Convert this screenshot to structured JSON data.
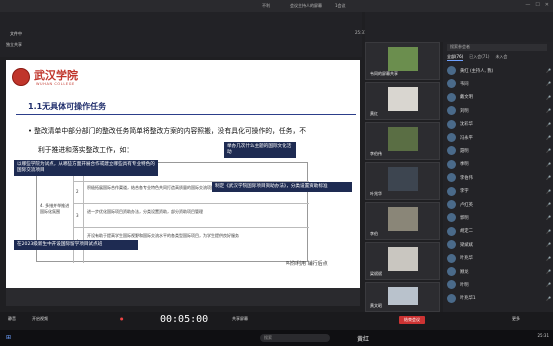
{
  "window": {
    "title_prefix": "不利",
    "title": "会议主持人的屏幕",
    "title_suffix": "1会议",
    "time_display": "25:31"
  },
  "toolbar": {
    "file_label": "文件中",
    "back_label": "独立共享"
  },
  "slide": {
    "school_name": "武汉学院",
    "school_en": "WUHAN COLLEGE",
    "section_title": "1.1无具体可操作任务",
    "bullet_1": "• 整改清单中部分部门的整改任务简单将整改方案的内容照搬，没有具化可操作的，任务，不",
    "bullet_2": "利于推进和落实整改工作，如：",
    "table": {
      "row_label": "4. 多措并举推进国际化氛围",
      "rows": [
        {
          "num": "1",
          "text": "积极拓展国际合作渠道，加强国际化"
        },
        {
          "num": "2",
          "text": "积极拓展国际合作渠道，结合各专业特色共同打造高质量的国际交流项目"
        },
        {
          "num": "3",
          "text": "进一步优化国际项目资助办法，分类设置资助，部分资助项目管理"
        },
        {
          "num": "4",
          "text": "开设有助于提高学生国际视野和国际交流水平的各类型国际项目，为学生提供良好服务"
        }
      ]
    },
    "notes": [
      "以哪些学院为试点，从哪些方面开展合作或建立哪些具有专业特色的国际交流项目",
      "举办几次什么主题的国际文化活动",
      "制定《武汉学院国际项目资助办法》，分类设置资助标准",
      "在2023级新生中开设国际留学项目试点班"
    ],
    "signature": "叫你利用 辅行后点"
  },
  "gallery": {
    "tiles": [
      {
        "label": "韦同的屏幕共享"
      },
      {
        "label": "黄红"
      },
      {
        "label": "李伯伟"
      },
      {
        "label": "叶兆华"
      },
      {
        "label": "李伯"
      },
      {
        "label": "梁斌斌"
      },
      {
        "label": "黄文昭"
      }
    ]
  },
  "participants": {
    "search_placeholder": "搜索参会者",
    "tabs": [
      "全部(76)",
      "已入会(71)",
      "未入会"
    ],
    "people": [
      {
        "name": "黄红 (主持人, 我)",
        "status": "mic"
      },
      {
        "name": "韦同",
        "status": "mic"
      },
      {
        "name": "戴文明",
        "status": "mic"
      },
      {
        "name": "刘明",
        "status": "mic"
      },
      {
        "name": "沈彩华",
        "status": "mic"
      },
      {
        "name": "冯永平",
        "status": "mic"
      },
      {
        "name": "聂明",
        "status": "mic"
      },
      {
        "name": "季明",
        "status": "mic"
      },
      {
        "name": "李伯伟",
        "status": "mic"
      },
      {
        "name": "李宇",
        "status": "mic"
      },
      {
        "name": "卢红英",
        "status": "mic"
      },
      {
        "name": "郭明",
        "status": "mic"
      },
      {
        "name": "胡定二",
        "status": "mic"
      },
      {
        "name": "梁斌斌",
        "status": "mic"
      },
      {
        "name": "叶兆华",
        "status": "mic"
      },
      {
        "name": "顾龙",
        "status": "mic"
      },
      {
        "name": "叶明",
        "status": "mic"
      },
      {
        "name": "叶兆华1",
        "status": "mic"
      }
    ]
  },
  "controls": {
    "timer": "00:05:00",
    "mute_label": "静音",
    "video_label": "开启视频",
    "end_label": "结束会议",
    "share_label": "共享屏幕",
    "more_label": "更多"
  },
  "taskbar": {
    "search_placeholder": "搜索",
    "user": "黄红"
  }
}
